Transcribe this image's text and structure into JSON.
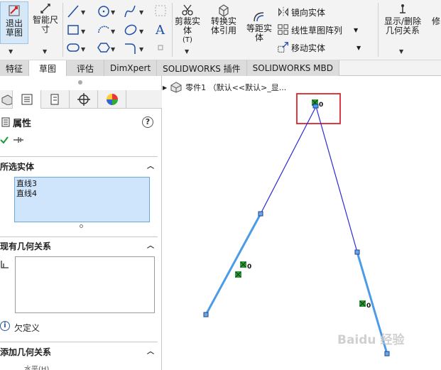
{
  "ribbon": {
    "exit_sketch": "退出草图",
    "smart_dimension": "智能尺寸",
    "trim_entities": "剪裁实体",
    "trim_shortcut": "(T)",
    "convert_entities": "转换实体引用",
    "offset_entities": "等距实体",
    "mirror_entities": "镜向实体",
    "linear_pattern": "线性草图阵列",
    "move_entities": "移动实体",
    "display_delete_relations": "显示/删除几何关系",
    "repair_sketch": "修"
  },
  "tabs": [
    {
      "label": "特征"
    },
    {
      "label": "草图"
    },
    {
      "label": "评估"
    },
    {
      "label": "DimXpert"
    },
    {
      "label": "SOLIDWORKS 插件"
    },
    {
      "label": "SOLIDWORKS MBD"
    }
  ],
  "panel": {
    "title": "属性",
    "help": "?",
    "selected_entities_title": "所选实体",
    "selected_entities": [
      "直线3",
      "直线4"
    ],
    "existing_relations_title": "现有几何关系",
    "status": "欠定义",
    "add_relations_title": "添加几何关系",
    "horizontal_option": "水平(H)"
  },
  "graphics": {
    "tree_label": "零件1 （默认<<默认>_显...",
    "relation_badge": "0",
    "highlight_color": "#d9262c",
    "line_color": "#2a2ad6",
    "selected_color": "#4a9be8",
    "watermark": "Baidu 经验"
  }
}
